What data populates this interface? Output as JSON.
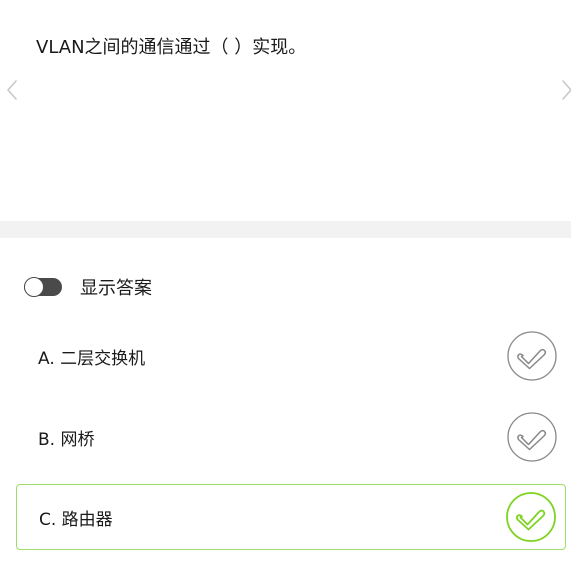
{
  "question": {
    "text": "VLAN之间的通信通过（ ）实现。"
  },
  "navigation": {
    "prev_icon": "chevron-left-icon",
    "next_icon": "chevron-right-icon"
  },
  "answer_toggle": {
    "label": "显示答案",
    "enabled": false
  },
  "options": [
    {
      "text": "A. 二层交换机",
      "icon": "check-circle-icon",
      "status": "unselected"
    },
    {
      "text": "B. 网桥",
      "icon": "check-circle-icon",
      "status": "unselected"
    },
    {
      "text": "C. 路由器",
      "icon": "check-circle-icon",
      "status": "correct"
    }
  ],
  "colors": {
    "correct": "#7ed321",
    "correct_border": "#9fdc6a",
    "neutral_icon": "#888888",
    "divider": "#f2f2f2"
  }
}
